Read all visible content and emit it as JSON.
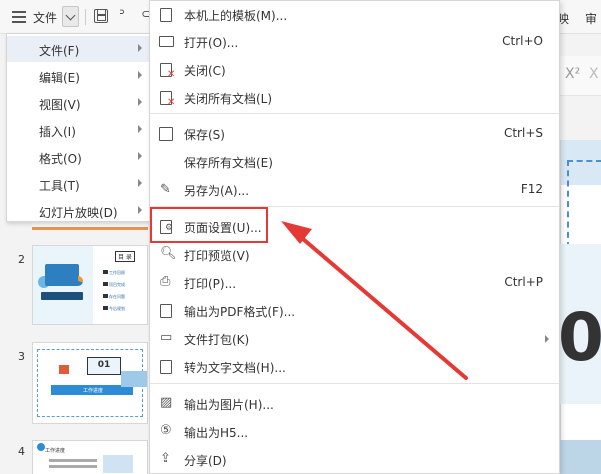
{
  "toolbar": {
    "file_label": "文件",
    "right_tab_1": "映",
    "right_tab_2": "审"
  },
  "left_menu": {
    "items": [
      {
        "label": "文件(F)",
        "active": true,
        "submenu": true
      },
      {
        "label": "编辑(E)",
        "submenu": true
      },
      {
        "label": "视图(V)",
        "submenu": true
      },
      {
        "label": "插入(I)",
        "submenu": true
      },
      {
        "label": "格式(O)",
        "submenu": true
      },
      {
        "label": "工具(T)",
        "submenu": true
      },
      {
        "label": "幻灯片放映(D)",
        "submenu": true
      }
    ]
  },
  "file_menu": {
    "items": [
      {
        "label": "本机上的模板(M)...",
        "icon": "template-doc-icon"
      },
      {
        "label": "打开(O)...",
        "shortcut": "Ctrl+O",
        "icon": "folder-open-icon"
      },
      {
        "label": "关闭(C)",
        "icon": "close-doc-icon"
      },
      {
        "label": "关闭所有文档(L)",
        "icon": "close-all-docs-icon"
      },
      {
        "label": "保存(S)",
        "shortcut": "Ctrl+S",
        "icon": "save-icon"
      },
      {
        "label": "保存所有文档(E)",
        "icon": "none"
      },
      {
        "label": "另存为(A)...",
        "shortcut": "F12",
        "icon": "save-as-icon"
      },
      {
        "label": "页面设置(U)...",
        "icon": "page-setup-icon"
      },
      {
        "label": "打印预览(V)",
        "icon": "print-preview-icon"
      },
      {
        "label": "打印(P)...",
        "shortcut": "Ctrl+P",
        "icon": "printer-icon"
      },
      {
        "label": "输出为PDF格式(F)...",
        "icon": "pdf-export-icon"
      },
      {
        "label": "文件打包(K)",
        "submenu": true,
        "icon": "package-icon"
      },
      {
        "label": "转为文字文档(H)...",
        "icon": "convert-doc-icon"
      },
      {
        "label": "输出为图片(H)...",
        "icon": "image-export-icon"
      },
      {
        "label": "输出为H5...",
        "icon": "h5-export-icon"
      },
      {
        "label": "分享(D)",
        "icon": "share-icon"
      }
    ]
  },
  "thumbnails": {
    "numbers": [
      "2",
      "3",
      "4"
    ],
    "slide2_title": "目 录",
    "slide2_lines": [
      "工作回顾",
      "项目完成",
      "存在问题",
      "今后规划"
    ],
    "slide3_box": "01",
    "slide3_banner": "工作进度",
    "slide4_title": "工作进度"
  },
  "slide": {
    "big_digit": "0"
  },
  "ribbon": {
    "superscript_label": "X²",
    "x_label": "X"
  },
  "colors": {
    "highlight": "#e53935",
    "menu_active": "#e9eef7",
    "accent_blue": "#2d8cd6"
  }
}
